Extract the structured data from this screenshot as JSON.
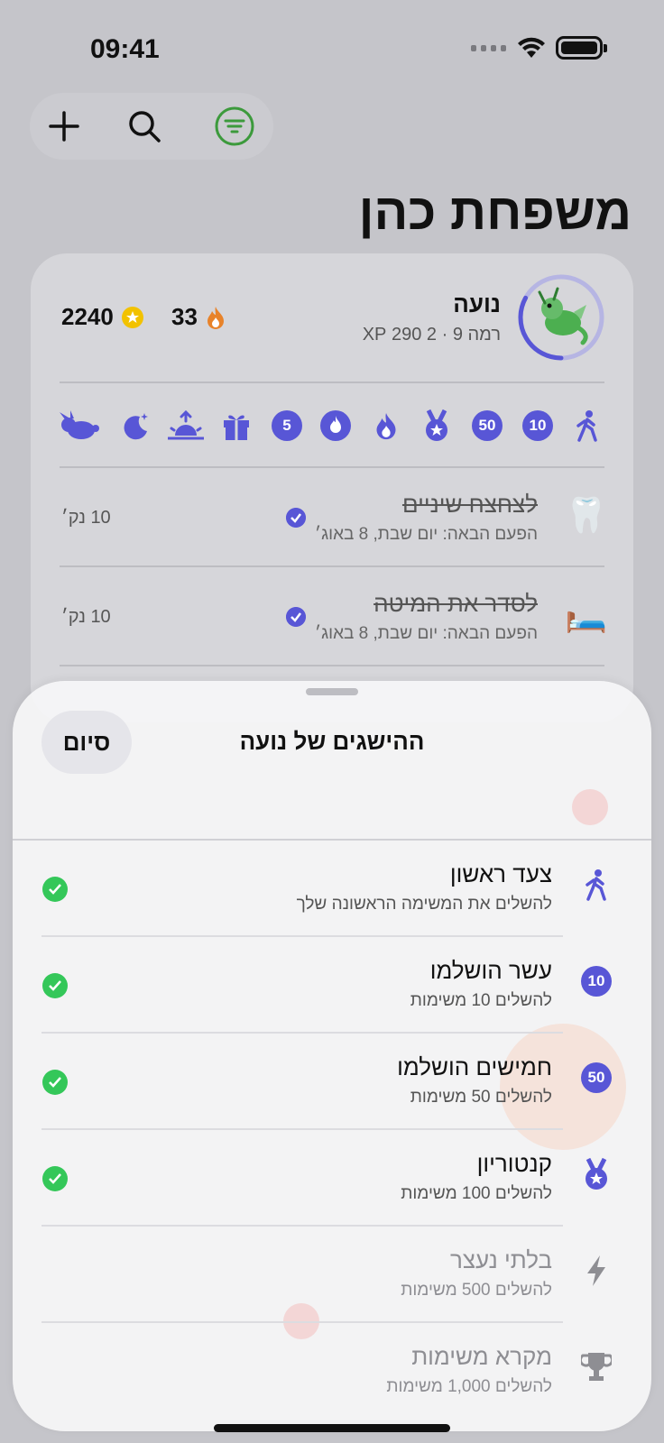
{
  "status_bar": {
    "time": "09:41"
  },
  "page": {
    "title": "משפחת כהן"
  },
  "child": {
    "name": "נועה",
    "level_line": "רמה 9 · 2 290 XP",
    "streak": "33",
    "coins": "2240",
    "level_progress": 0.33
  },
  "badges": [
    "walk-icon",
    "10",
    "50",
    "medal-icon",
    "flame-icon",
    "flame-circle-icon",
    "5",
    "gift-icon",
    "sunrise-icon",
    "moon-icon",
    "rabbit-icon"
  ],
  "tasks": [
    {
      "emoji": "🦷",
      "title": "לצחצח שיניים",
      "subtitle": "הפעם הבאה: יום שבת, 8 באוג׳",
      "points": "10 נק׳"
    },
    {
      "emoji": "🛏️",
      "title": "לסדר את המיטה",
      "subtitle": "הפעם הבאה: יום שבת, 8 באוג׳",
      "points": "10 נק׳"
    }
  ],
  "sheet": {
    "title": "ההישגים של נועה",
    "done_label": "סיום",
    "achievements": [
      {
        "title": "צעד ראשון",
        "subtitle": "להשלים את המשימה הראשונה שלך",
        "icon": "walk-icon",
        "completed": true
      },
      {
        "title": "עשר הושלמו",
        "subtitle": "להשלים 10 משימות",
        "icon": "10",
        "completed": true
      },
      {
        "title": "חמישים הושלמו",
        "subtitle": "להשלים 50 משימות",
        "icon": "50",
        "completed": true
      },
      {
        "title": "קנטוריון",
        "subtitle": "להשלים 100 משימות",
        "icon": "medal-icon",
        "completed": true
      },
      {
        "title": "בלתי נעצר",
        "subtitle": "להשלים 500 משימות",
        "icon": "bolt-icon",
        "completed": false
      },
      {
        "title": "מקרא משימות",
        "subtitle": "להשלים 1,000 משימות",
        "icon": "trophy-icon",
        "completed": false
      }
    ]
  },
  "colors": {
    "accent": "#5856d6",
    "check": "#34c759",
    "filter": "#3c9a3c",
    "coin": "#f2c200",
    "flame": "#e8832a"
  }
}
